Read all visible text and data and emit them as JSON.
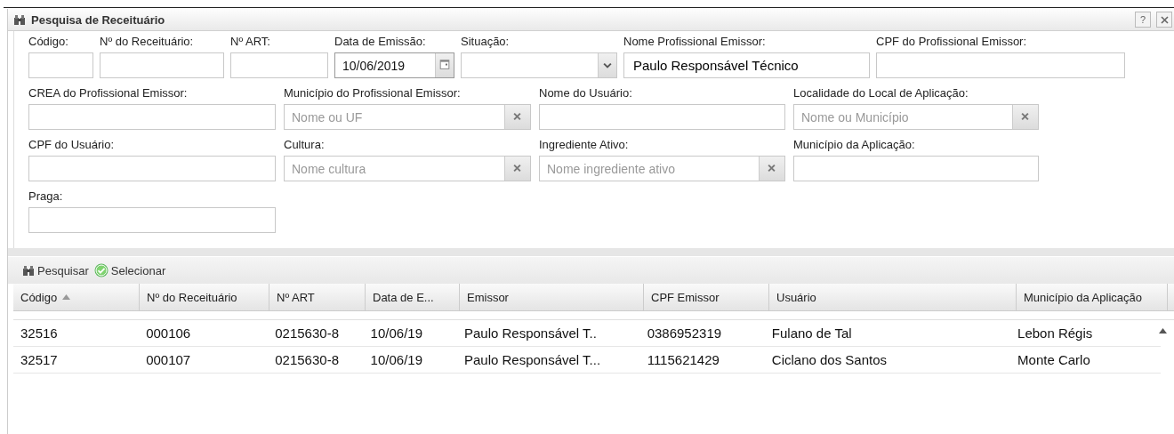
{
  "window": {
    "title": "Pesquisa de Receituário",
    "help_button": "?"
  },
  "form": {
    "rows": [
      [
        {
          "kind": "text",
          "label": "Código:"
        },
        {
          "kind": "text",
          "label": "Nº do Receituário:"
        },
        {
          "kind": "text",
          "label": "Nº ART:"
        },
        {
          "kind": "date",
          "label": "Data de Emissão:",
          "value": "10/06/2019"
        },
        {
          "kind": "select",
          "label": "Situação:"
        },
        {
          "kind": "text",
          "label": "Nome Profissional Emissor:",
          "value": "Paulo Responsável Técnico"
        },
        {
          "kind": "text",
          "label": "CPF do Profissional Emissor:"
        }
      ],
      [
        {
          "kind": "text",
          "label": "CREA do Profissional Emissor:"
        },
        {
          "kind": "autocomplete",
          "label": "Município do Profissional Emissor:",
          "placeholder": "Nome ou UF"
        },
        {
          "kind": "text",
          "label": "Nome do Usuário:"
        },
        {
          "kind": "autocomplete",
          "label": "Localidade do Local de Aplicação:",
          "placeholder": "Nome ou Município"
        }
      ],
      [
        {
          "kind": "text",
          "label": "CPF do Usuário:"
        },
        {
          "kind": "autocomplete",
          "label": "Cultura:",
          "placeholder": "Nome cultura"
        },
        {
          "kind": "autocomplete",
          "label": "Ingrediente Ativo:",
          "placeholder": "Nome ingrediente ativo"
        },
        {
          "kind": "text",
          "label": "Município da Aplicação:"
        }
      ],
      [
        {
          "kind": "text",
          "label": "Praga:"
        }
      ]
    ]
  },
  "toolbar": [
    {
      "kind": "search",
      "label": "Pesquisar"
    },
    {
      "kind": "select",
      "label": "Selecionar"
    }
  ],
  "table": {
    "columns": [
      {
        "label": "Código",
        "sorted": true
      },
      {
        "label": "Nº do Receituário",
        "sorted": false
      },
      {
        "label": "Nº ART",
        "sorted": false
      },
      {
        "label": "Data de E...",
        "sorted": false
      },
      {
        "label": "Emissor",
        "sorted": false
      },
      {
        "label": "CPF Emissor",
        "sorted": false
      },
      {
        "label": "Usuário",
        "sorted": false
      },
      {
        "label": "Município da Aplicação",
        "sorted": false
      }
    ],
    "rows": [
      [
        "32516",
        "000106",
        "0215630-8",
        "10/06/19",
        "Paulo Responsável T..",
        "0386952319",
        "Fulano de Tal",
        "Lebon Régis"
      ],
      [
        "32517",
        "000107",
        "0215630-8",
        "10/06/19",
        "Paulo Responsável T...",
        "1115621429",
        "Ciclano dos Santos",
        "Monte Carlo"
      ]
    ]
  }
}
